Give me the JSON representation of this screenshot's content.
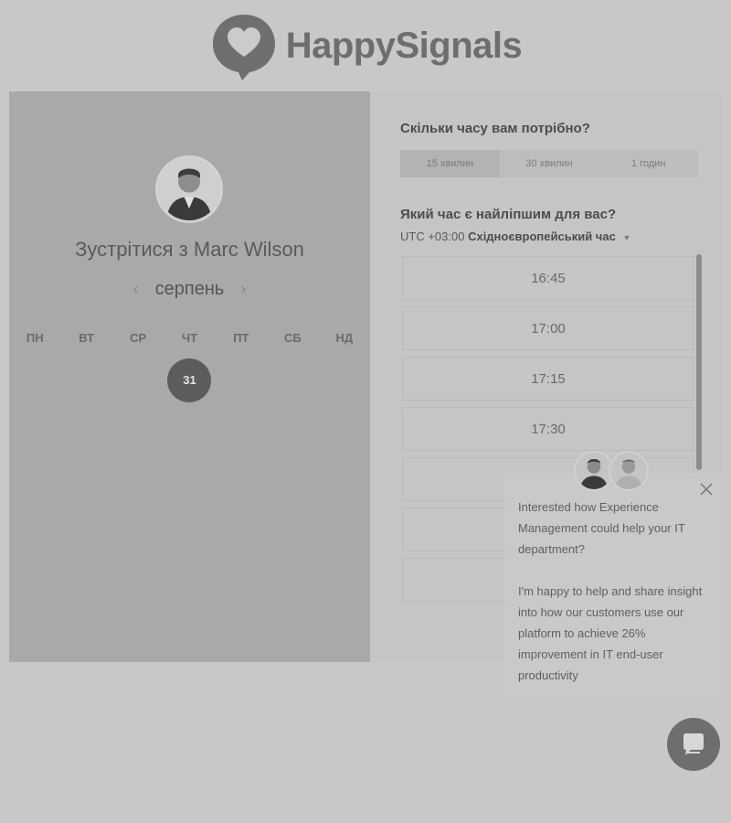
{
  "brand": {
    "name": "HappySignals"
  },
  "left_panel": {
    "title": "Зустрітися з Marc Wilson",
    "month": "серпень",
    "weekdays": [
      "ПН",
      "ВТ",
      "СР",
      "ЧТ",
      "ПТ",
      "СБ",
      "НД"
    ],
    "days": [
      "",
      "",
      "",
      "",
      "",
      "",
      "",
      "",
      "",
      "",
      "",
      "",
      "",
      "",
      "",
      "",
      "",
      "",
      "",
      "",
      "",
      "",
      "",
      "",
      "",
      "",
      "",
      "",
      "",
      "",
      "",
      "",
      "",
      "",
      ""
    ],
    "selected_day": "31"
  },
  "right_panel": {
    "duration_question": "Скільки часу вам потрібно?",
    "durations": [
      "15 хвилин",
      "30 хвилин",
      "1 годин"
    ],
    "time_question": "Який час є найліпшим для вас?",
    "timezone_offset": "UTC +03:00",
    "timezone_name": "Східноєвропейський час",
    "slots": [
      "16:45",
      "17:00",
      "17:15",
      "17:30",
      "",
      "",
      ""
    ]
  },
  "popup": {
    "paragraph_1": "Interested how Experience Management could help your IT department?",
    "paragraph_2": "I'm happy to help and share insight into how our customers use our platform to achieve 26% improvement in IT end-user productivity"
  },
  "icons": {
    "logo": "speech-bubble-heart-icon",
    "prev": "chevron-left-icon",
    "next": "chevron-right-icon",
    "timezone": "caret-down-icon",
    "close": "close-icon",
    "chat": "chat-icon"
  }
}
